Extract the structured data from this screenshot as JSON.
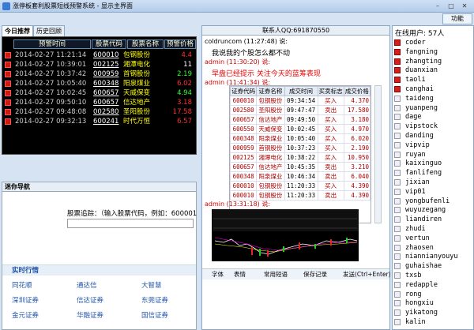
{
  "window": {
    "title": "涨停板套利股票短线预警系统 - 显示主界面",
    "func_btn": "功能"
  },
  "left": {
    "tabs": [
      "今日推荐",
      "历史回顾"
    ],
    "headers": [
      "预警时间",
      "股票代码",
      "股票名称",
      "预警价格"
    ],
    "rows": [
      {
        "time": "2014-02-27 11:21:14",
        "code": "600010",
        "name": "包钢股份",
        "val": "4.4",
        "color": "#ff3030"
      },
      {
        "time": "2014-02-27 10:39:01",
        "code": "002125",
        "name": "湘潭电化",
        "val": "11",
        "color": "#ffffff"
      },
      {
        "time": "2014-02-27 10:37:42",
        "code": "000959",
        "name": "首钢股份",
        "val": "2.19",
        "color": "#30ff30"
      },
      {
        "time": "2014-02-27 10:05:40",
        "code": "600348",
        "name": "阳泉煤业",
        "val": "6.02",
        "color": "#ff3030"
      },
      {
        "time": "2014-02-27 10:02:45",
        "code": "600657",
        "name": "天威保变",
        "val": "4.94",
        "color": "#30ff30"
      },
      {
        "time": "2014-02-27 09:50:10",
        "code": "600657",
        "name": "信达地产",
        "val": "3.18",
        "color": "#ff3030"
      },
      {
        "time": "2014-02-27 09:48:08",
        "code": "002580",
        "name": "圣阳股份",
        "val": "17.58",
        "color": "#ff3030"
      },
      {
        "time": "2014-02-27 09:32:13",
        "code": "600241",
        "name": "时代万恒",
        "val": "6.57",
        "color": "#ff3030"
      }
    ],
    "nav_title": "迷你导航",
    "track_label": "股票追踪：（输入股票代码，例如：600001",
    "realtime_title": "实时行情",
    "brokers": [
      [
        "同花顺",
        "通达信",
        "大智慧"
      ],
      [
        "深圳证券",
        "信达证券",
        "东莞证券"
      ],
      [
        "金元证券",
        "华融证券",
        "国信证券"
      ]
    ]
  },
  "chat": {
    "contact": "联系人QQ:691870550",
    "m1_meta": "coldruncom (11:27:48) 说:",
    "m1_text": "我说我的个股怎么都不动",
    "m2_meta": "admin (11:30:20) 说:",
    "m2_text": "早盘已经提示 关注今天的蓝筹表现",
    "m3_meta": "admin (11:41:34) 说:",
    "table_headers": [
      "证券代码",
      "证券名称",
      "成交时间",
      "买卖标志",
      "成交价格"
    ],
    "table_rows": [
      [
        "600010",
        "包钢股份",
        "09:34:54",
        "买入",
        "4.370"
      ],
      [
        "002580",
        "圣阳股份",
        "09:47:47",
        "卖出",
        "17.580"
      ],
      [
        "600657",
        "信达地产",
        "09:49:50",
        "买入",
        "3.180"
      ],
      [
        "600550",
        "天威保变",
        "10:02:45",
        "买入",
        "4.970"
      ],
      [
        "600348",
        "阳泉煤业",
        "10:05:40",
        "买入",
        "6.020"
      ],
      [
        "000959",
        "首钢股份",
        "10:37:23",
        "买入",
        "2.190"
      ],
      [
        "002125",
        "湘潭电化",
        "10:38:22",
        "买入",
        "10.950"
      ],
      [
        "600657",
        "信达地产",
        "10:45:35",
        "卖出",
        "3.210"
      ],
      [
        "600348",
        "阳泉煤业",
        "10:46:34",
        "卖出",
        "6.040"
      ],
      [
        "600010",
        "包钢股份",
        "11:20:33",
        "买入",
        "4.390"
      ],
      [
        "600010",
        "包钢股份",
        "11:20:33",
        "卖出",
        "4.390"
      ]
    ],
    "m4_meta": "admin (13:31:18) 说:",
    "toolbar": [
      "字体",
      "表情",
      "常用短语",
      "保存记录",
      "发送(Ctrl+Enter)"
    ]
  },
  "users": {
    "online": "在线用户: 57人",
    "list": [
      {
        "name": "coder",
        "red": true
      },
      {
        "name": "fangning",
        "red": true
      },
      {
        "name": "zhangting",
        "red": true
      },
      {
        "name": "duanxian",
        "red": true
      },
      {
        "name": "taoli",
        "red": true
      },
      {
        "name": "canghai",
        "red": true
      },
      {
        "name": "taideng",
        "red": false
      },
      {
        "name": "yuanpeng",
        "red": false
      },
      {
        "name": "dage",
        "red": false
      },
      {
        "name": "vipstock",
        "red": false
      },
      {
        "name": "danding",
        "red": false
      },
      {
        "name": "vipvip",
        "red": false
      },
      {
        "name": "ruyan",
        "red": false
      },
      {
        "name": "kaixinguo",
        "red": false
      },
      {
        "name": "fanlifeng",
        "red": false
      },
      {
        "name": "jixian",
        "red": false
      },
      {
        "name": "vip01",
        "red": false
      },
      {
        "name": "yongbufenli",
        "red": false
      },
      {
        "name": "wuyuzegang",
        "red": false
      },
      {
        "name": "liandiren",
        "red": false
      },
      {
        "name": "zhudi",
        "red": false
      },
      {
        "name": "vertun",
        "red": false
      },
      {
        "name": "zhaosen",
        "red": false
      },
      {
        "name": "niannianyouyu",
        "red": false
      },
      {
        "name": "guhaishae",
        "red": false
      },
      {
        "name": "txsb",
        "red": false
      },
      {
        "name": "redapple",
        "red": false
      },
      {
        "name": "rong",
        "red": false
      },
      {
        "name": "hongxiu",
        "red": false
      },
      {
        "name": "yikatong",
        "red": false
      },
      {
        "name": "kalin",
        "red": false
      }
    ]
  }
}
